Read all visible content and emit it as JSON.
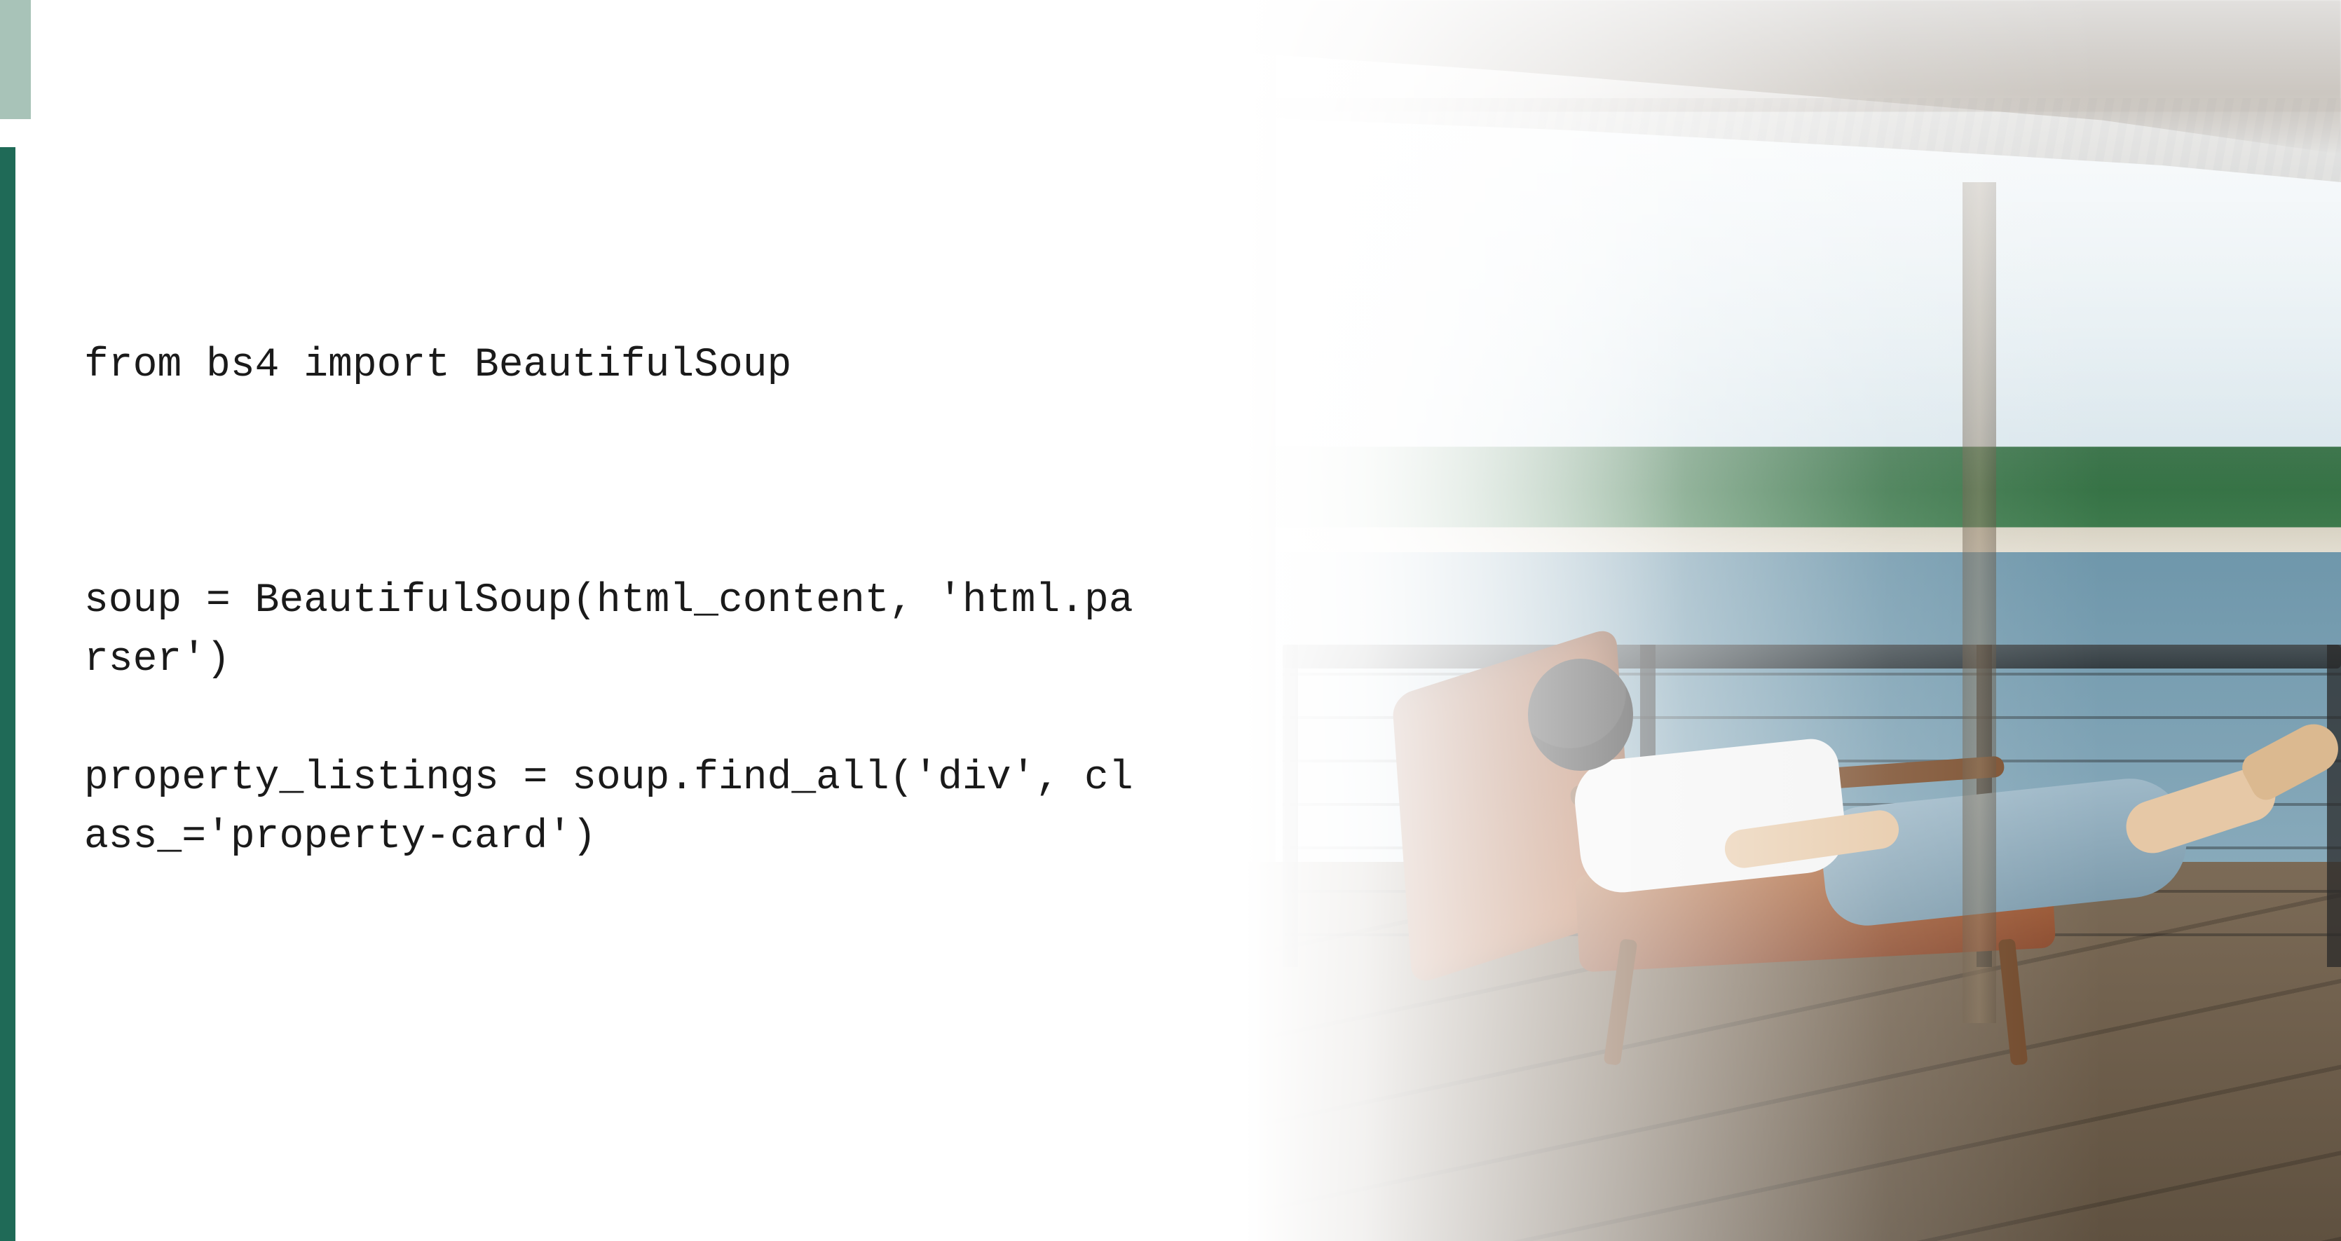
{
  "code": {
    "lines": [
      "from bs4 import BeautifulSoup",
      "",
      "",
      "",
      "soup = BeautifulSoup(html_content, 'html.parser')",
      "",
      "property_listings = soup.find_all('div', class_='property-card')"
    ]
  }
}
